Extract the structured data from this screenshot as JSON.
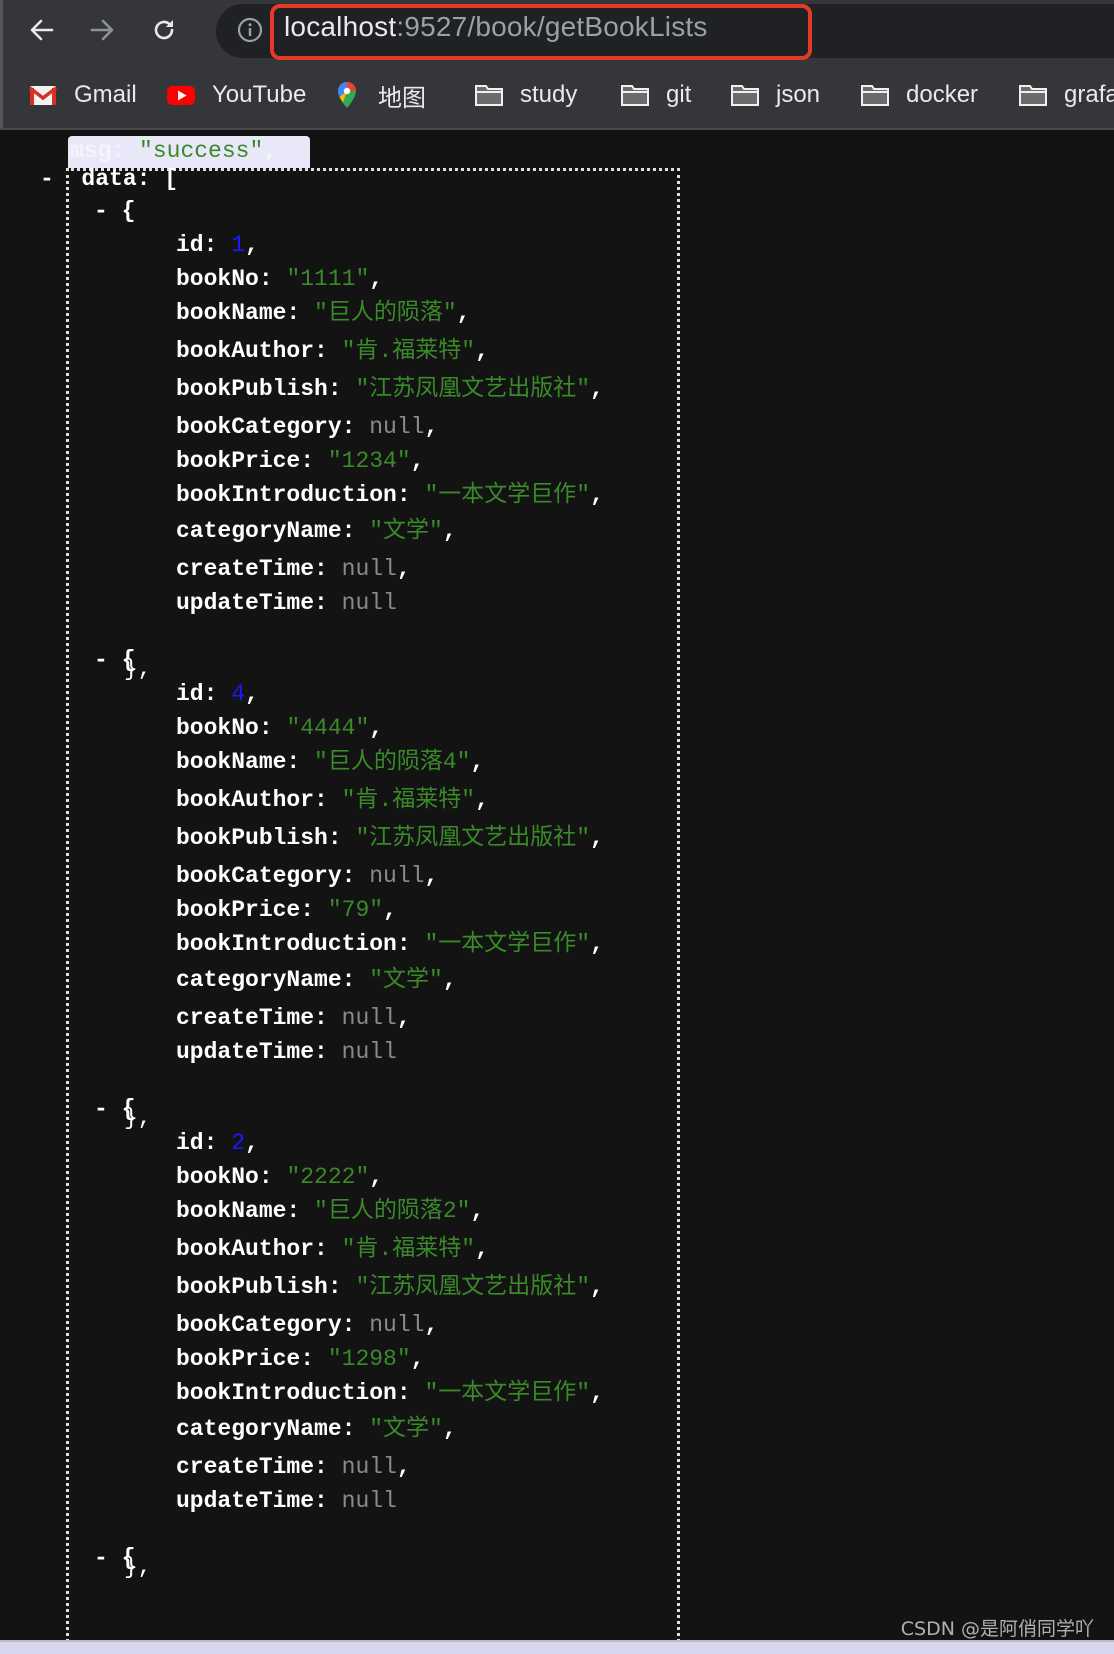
{
  "browser": {
    "url_host": "localhost",
    "url_rest": ":9527/book/getBookLists",
    "nav": {
      "back": "back-arrow-icon",
      "forward": "forward-arrow-icon",
      "reload": "reload-icon",
      "info": "info-icon"
    },
    "bookmarks": [
      {
        "label": "Gmail",
        "icon": "gmail-icon"
      },
      {
        "label": "YouTube",
        "icon": "youtube-icon"
      },
      {
        "label": "地图",
        "icon": "maps-pin-icon"
      },
      {
        "label": "study",
        "icon": "folder-icon"
      },
      {
        "label": "git",
        "icon": "folder-icon"
      },
      {
        "label": "json",
        "icon": "folder-icon"
      },
      {
        "label": "docker",
        "icon": "folder-icon"
      },
      {
        "label": "grafa",
        "icon": "folder-icon"
      }
    ],
    "colors": {
      "toolbar_bg": "#35363a",
      "omnibox_bg": "#202124",
      "highlight_border": "#e23b2a"
    }
  },
  "json_view": {
    "msg_key": "msg",
    "msg_value": "\"success\"",
    "data_key": "data",
    "toggle_symbol": "-",
    "open_bracket": "[",
    "open_brace": "{",
    "close_brace": "},",
    "field_keys": [
      "id",
      "bookNo",
      "bookName",
      "bookAuthor",
      "bookPublish",
      "bookCategory",
      "bookPrice",
      "bookIntroduction",
      "categoryName",
      "createTime",
      "updateTime"
    ],
    "records": [
      {
        "id": "1",
        "bookNo": "\"1111\"",
        "bookName": "\"巨人的陨落\"",
        "bookAuthor": "\"肯.福莱特\"",
        "bookPublish": "\"江苏凤凰文艺出版社\"",
        "bookCategory": "null",
        "bookPrice": "\"1234\"",
        "bookIntroduction": "\"一本文学巨作\"",
        "categoryName": "\"文学\"",
        "createTime": "null",
        "updateTime": "null"
      },
      {
        "id": "4",
        "bookNo": "\"4444\"",
        "bookName": "\"巨人的陨落4\"",
        "bookAuthor": "\"肯.福莱特\"",
        "bookPublish": "\"江苏凤凰文艺出版社\"",
        "bookCategory": "null",
        "bookPrice": "\"79\"",
        "bookIntroduction": "\"一本文学巨作\"",
        "categoryName": "\"文学\"",
        "createTime": "null",
        "updateTime": "null"
      },
      {
        "id": "2",
        "bookNo": "\"2222\"",
        "bookName": "\"巨人的陨落2\"",
        "bookAuthor": "\"肯.福莱特\"",
        "bookPublish": "\"江苏凤凰文艺出版社\"",
        "bookCategory": "null",
        "bookPrice": "\"1298\"",
        "bookIntroduction": "\"一本文学巨作\"",
        "categoryName": "\"文学\"",
        "createTime": "null",
        "updateTime": "null"
      }
    ],
    "colors": {
      "background": "#131313",
      "key": "#ffffff",
      "string": "#3a8a2a",
      "number": "#1a1aff",
      "null": "#8a8a8a"
    }
  },
  "watermark": "CSDN @是阿俏同学吖"
}
